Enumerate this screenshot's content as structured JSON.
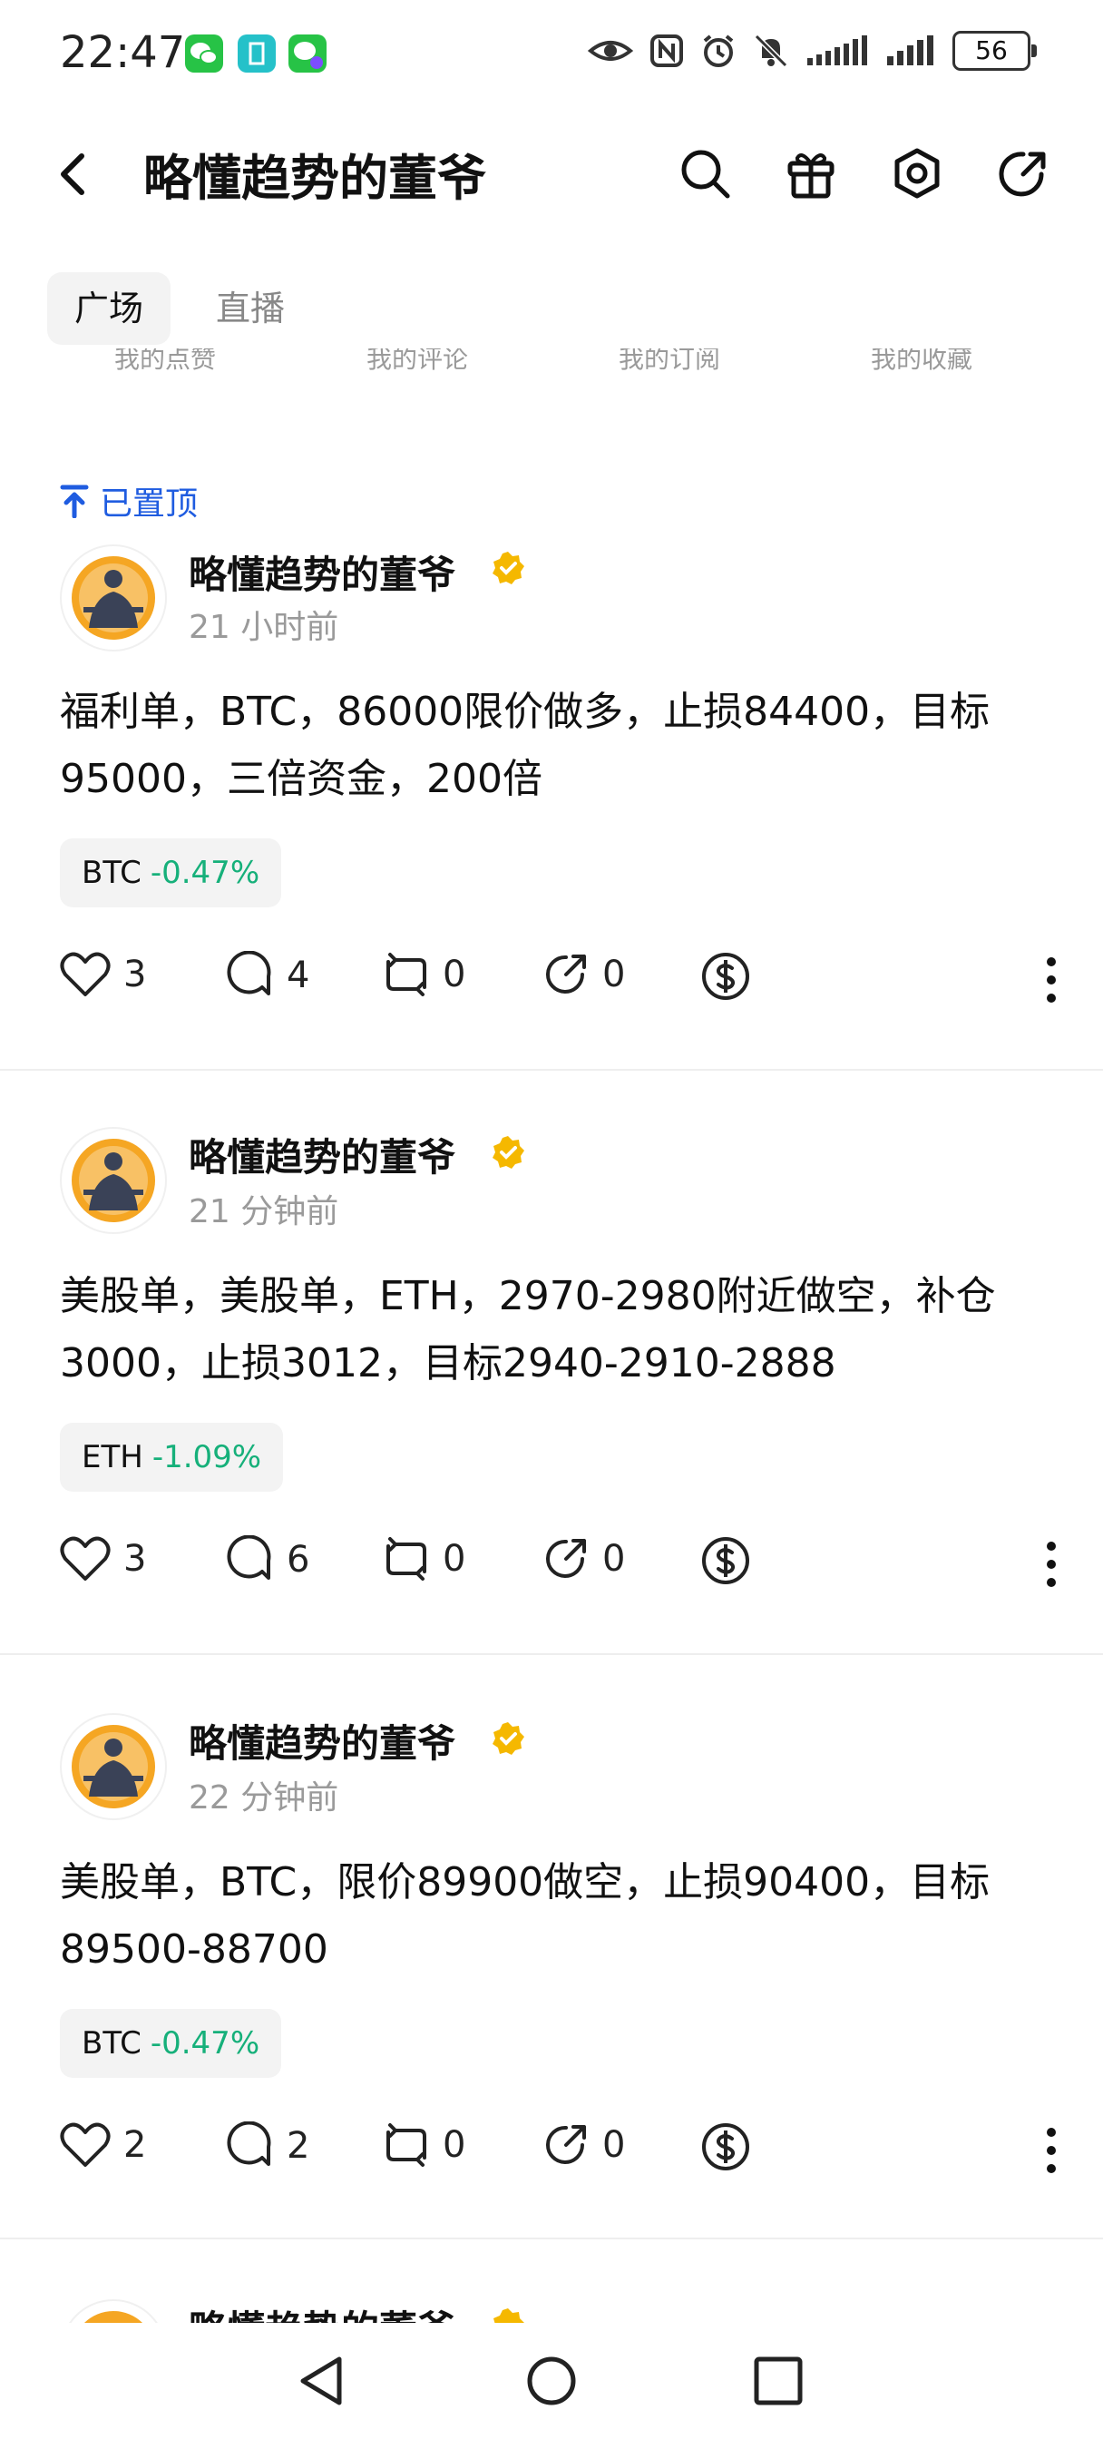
{
  "status_bar": {
    "time": "22:47",
    "battery": "56",
    "app_icons": [
      "wechat-icon",
      "vpn-icon",
      "wechat-work-icon"
    ],
    "right_icons": [
      "eye-icon",
      "nfc-icon",
      "alarm-icon",
      "mute-icon",
      "signal-icon",
      "signal-icon"
    ]
  },
  "header": {
    "title": "略懂趋势的董爷",
    "icons": [
      "back-icon",
      "search-icon",
      "gift-icon",
      "settings-icon",
      "share-icon"
    ]
  },
  "tabs": [
    {
      "label": "广场",
      "active": true
    },
    {
      "label": "直播",
      "active": false
    }
  ],
  "subtabs": [
    "我的点赞",
    "我的评论",
    "我的订阅",
    "我的收藏"
  ],
  "pinned_label": "已置顶",
  "posts": [
    {
      "author": "略懂趋势的董爷",
      "time": "21 小时前",
      "text": "福利单，BTC，86000限价做多，止损84400，目标95000，三倍资金，200倍",
      "chip": {
        "symbol": "BTC",
        "change": "-0.47%"
      },
      "likes": "3",
      "comments": "4",
      "reposts": "0",
      "shares": "0"
    },
    {
      "author": "略懂趋势的董爷",
      "time": "21 分钟前",
      "text": "美股单，美股单，ETH，2970-2980附近做空，补仓3000，止损3012，目标2940-2910-2888",
      "chip": {
        "symbol": "ETH",
        "change": "-1.09%"
      },
      "likes": "3",
      "comments": "6",
      "reposts": "0",
      "shares": "0"
    },
    {
      "author": "略懂趋势的董爷",
      "time": "22 分钟前",
      "text": "美股单，BTC，限价89900做空，止损90400，目标89500-88700",
      "chip": {
        "symbol": "BTC",
        "change": "-0.47%"
      },
      "likes": "2",
      "comments": "2",
      "reposts": "0",
      "shares": "0"
    }
  ],
  "partial_post": {
    "author": "略懂趋势的董爷"
  },
  "colors": {
    "accent_blue": "#1f5ce0",
    "positive_green": "#16b07a",
    "verified_gold": "#f5b800"
  }
}
